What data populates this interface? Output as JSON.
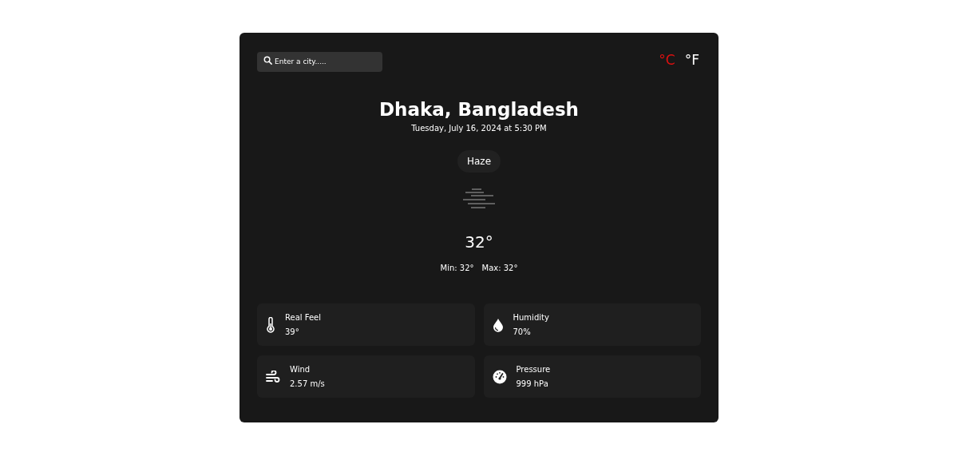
{
  "search": {
    "placeholder": "Enter a city....."
  },
  "units": [
    {
      "label": "°C",
      "selected": true
    },
    {
      "label": "°F",
      "selected": false
    }
  ],
  "location": "Dhaka, Bangladesh",
  "datetime": "Tuesday, July 16, 2024 at 5:30 PM",
  "condition": "Haze",
  "temperature": "32°",
  "min": "Min: 32°",
  "max": "Max: 32°",
  "stats": [
    {
      "kind": "thermometer",
      "label": "Real Feel",
      "value": "39°"
    },
    {
      "kind": "drop",
      "label": "Humidity",
      "value": "70%"
    },
    {
      "kind": "wind",
      "label": "Wind",
      "value": "2.57 m/s"
    },
    {
      "kind": "gauge",
      "label": "Pressure",
      "value": "999 hPa"
    }
  ]
}
